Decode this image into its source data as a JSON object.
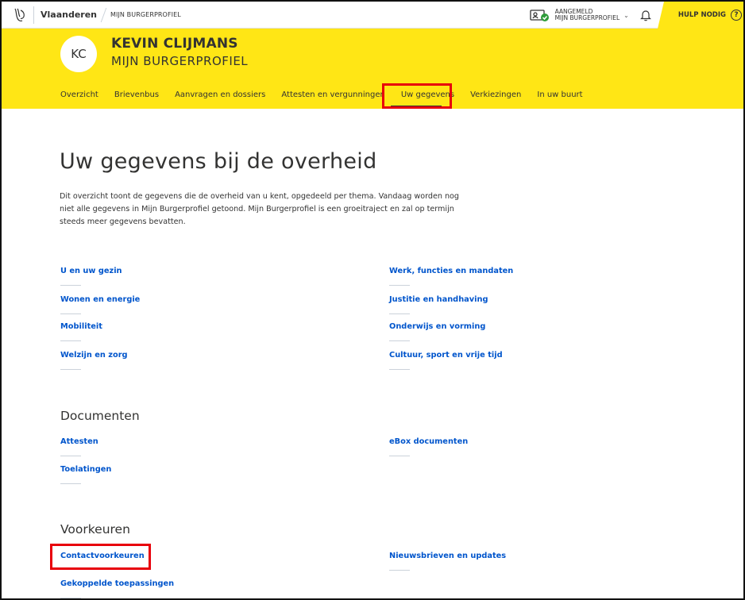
{
  "global_header": {
    "host": "Vlaanderen",
    "app": "MIJN BURGERPROFIEL",
    "status_line1": "AANGEMELD",
    "status_line2": "MIJN BURGERPROFIEL",
    "help": "HULP NODIG",
    "help_icon": "?"
  },
  "profile": {
    "initials": "KC",
    "name": "KEVIN CLIJMANS",
    "subtitle": "MIJN BURGERPROFIEL"
  },
  "tabs": [
    "Overzicht",
    "Brievenbus",
    "Aanvragen en dossiers",
    "Attesten en vergunningen",
    "Uw gegevens",
    "Verkiezingen",
    "In uw buurt"
  ],
  "main": {
    "title": "Uw gegevens bij de overheid",
    "intro_lines": [
      "Dit overzicht toont de gegevens die de overheid van u kent, opgedeeld per thema. Vandaag worden nog",
      "niet alle gegevens in Mijn Burgerprofiel getoond. Mijn Burgerprofiel is een groeitraject en zal op termijn",
      "steeds meer gegevens bevatten."
    ]
  },
  "themes": {
    "left": [
      "U en uw gezin",
      "Wonen en energie",
      "Mobiliteit",
      "Welzijn en zorg"
    ],
    "right": [
      "Werk, functies en mandaten",
      "Justitie en handhaving",
      "Onderwijs en vorming",
      "Cultuur, sport en vrije tijd"
    ]
  },
  "documenten": {
    "heading": "Documenten",
    "left": [
      "Attesten",
      "Toelatingen"
    ],
    "right": [
      "eBox documenten"
    ]
  },
  "voorkeuren": {
    "heading": "Voorkeuren",
    "left": [
      "Contactvoorkeuren",
      "Gekoppelde toepassingen"
    ],
    "right": [
      "Nieuwsbrieven en updates"
    ]
  },
  "colors": {
    "brand_yellow": "#ffe615",
    "link_blue": "#0055cc",
    "highlight_red": "#e8000b"
  }
}
